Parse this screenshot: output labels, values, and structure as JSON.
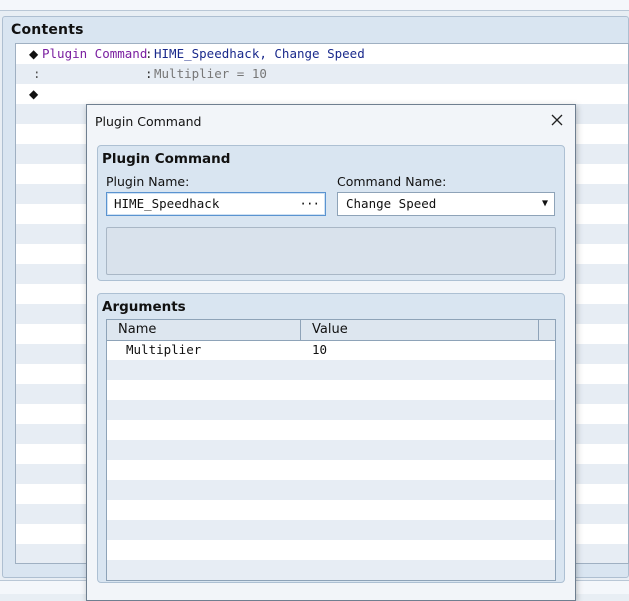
{
  "contents": {
    "title": "Contents",
    "events": [
      {
        "command": "Plugin Command",
        "separator": ":",
        "value": "HIME_Speedhack, Change Speed"
      },
      {
        "lead": ":",
        "separator": ":",
        "value": "Multiplier = 10"
      }
    ]
  },
  "dialog": {
    "title": "Plugin Command",
    "close_icon": "close-icon",
    "plugin_command_group": {
      "title": "Plugin Command",
      "plugin_name_label": "Plugin Name:",
      "plugin_name_value": "HIME_Speedhack",
      "browse_label": "···",
      "command_name_label": "Command Name:",
      "command_name_value": "Change Speed",
      "dropdown_arrow": "▼"
    },
    "arguments_group": {
      "title": "Arguments",
      "columns": [
        "Name",
        "Value"
      ],
      "rows": [
        {
          "name": "Multiplier",
          "value": "10"
        }
      ]
    }
  },
  "colors": {
    "command_purple": "#7a1fa0",
    "value_blue": "#1a2a8c",
    "panel_bg": "#d9e5f1",
    "focus_border": "#5a93d0"
  }
}
